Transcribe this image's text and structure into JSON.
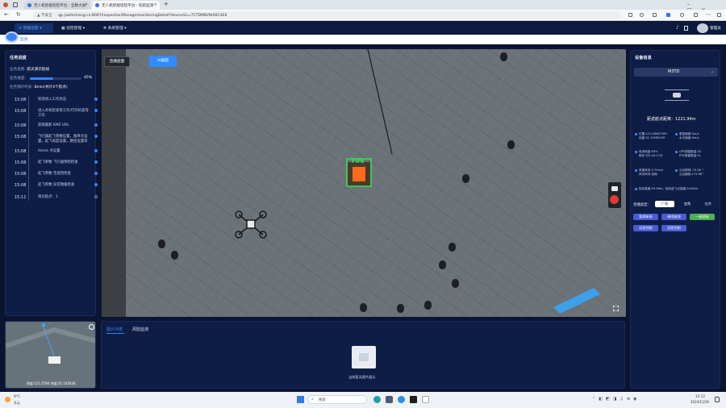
{
  "browser": {
    "tabs": [
      {
        "title": "无人机智能巡检平台 - 全数大屏",
        "active": false
      },
      {
        "title": "无人机智能巡检平台 - 巡航监测",
        "active": true
      }
    ],
    "new_tab": "+",
    "security_label": "不安全",
    "url": "qp.jiazhicheng.cn:8067/inspectionManage/monitoringDetail?deviceSn=7CTDM8VW00C4E6"
  },
  "app": {
    "menu": [
      "智能巡航",
      "巡检管理",
      "系统管理"
    ],
    "user": "管理员",
    "breadcrumb": "监测"
  },
  "task_panel": {
    "title": "任务进度",
    "name_label": "任务名称:",
    "name_value": "航天演示航线",
    "progress_label": "任务进度:",
    "progress_value": "45%",
    "progress_fraction": 0.45,
    "eta_label": "任务预计时长:",
    "eta_value": "8min(共计4个航点)",
    "steps": [
      {
        "time": "15:08",
        "desc": "机场进入工作状态",
        "state": "done"
      },
      {
        "time": "15:08",
        "desc": "进入开机检查等工作/打开机盖等工作",
        "state": "done"
      },
      {
        "time": "15:08",
        "desc": "获取最新 KMZ URL",
        "state": "done"
      },
      {
        "time": "15:08",
        "desc": "飞行器起飞参数设置，备降点设置，起飞高度设置，路径设置等",
        "state": "done"
      },
      {
        "time": "15:08",
        "desc": "Home 点设置",
        "state": "done"
      },
      {
        "time": "15:08",
        "desc": "起飞参数 飞行器预检检查",
        "state": "done"
      },
      {
        "time": "15:08",
        "desc": "起飞参数 无遮挡检查",
        "state": "done"
      },
      {
        "time": "15:08",
        "desc": "起飞参数 异常救援检查",
        "state": "done"
      },
      {
        "time": "15:11",
        "desc": "到达航点：1",
        "state": "loading"
      }
    ]
  },
  "video": {
    "tab_live": "直播画面",
    "tab_ai": "AI画面",
    "fire_label": "Fire"
  },
  "minimap": {
    "coords": "经度:121.0784 纬度:31.145634"
  },
  "bottom_panel": {
    "tabs": [
      "图片列表",
      "风险监测"
    ],
    "empty_text": "当前暂无图片展示"
  },
  "device": {
    "title": "设备信息",
    "model": "M3TD",
    "distance": "距返航点距离：1221.94m",
    "cells": [
      "位置:121.08467399\n纬度:31.15565299",
      "垂直速度:0m/s\n水平速度:0m/s",
      "电池电量:63%\n剩余飞行:18.17分",
      "GPS搜星数量:32\nRTK搜星数量:51",
      "风速风向:5.79m/s\n风向风向:西南",
      "云台俯仰:-74.50 °\n云台偏航:173.08 °",
      "相对高度:59.96m，相对起飞点高度:24.60m"
    ],
    "live_type_label": "直播类型:",
    "live_types": [
      "广角",
      "变焦",
      "红外"
    ],
    "buttons": [
      {
        "label": "暂停航线",
        "color": "#4a5bd6"
      },
      {
        "label": "继续航线",
        "color": "#4a5bd6"
      },
      {
        "label": "一键返航",
        "color": "#4caf50"
      },
      {
        "label": "远程控制",
        "color": "#4a5bd6"
      },
      {
        "label": "远程控制",
        "color": "#4a5bd6"
      }
    ]
  },
  "taskbar": {
    "weather_temp": "9°C",
    "weather_desc": "多云",
    "search_placeholder": "搜索",
    "time": "15:12",
    "date": "2024/12/26"
  },
  "colors": {
    "accent": "#2f6bff",
    "fire_box": "#2ee35a",
    "panel": "#0e1d45"
  }
}
